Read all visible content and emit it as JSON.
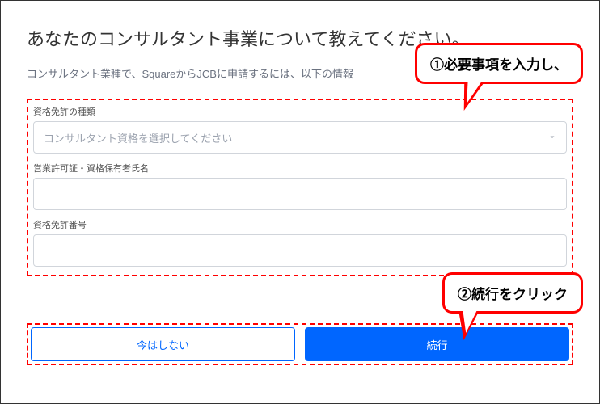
{
  "title": "あなたのコンサルタント事業について教えてください。",
  "description": "コンサルタント業種で、SquareからJCBに申請するには、以下の情報",
  "callouts": {
    "one": "①必要事項を入力し、",
    "two": "②続行をクリック"
  },
  "fields": {
    "license_type": {
      "label": "資格免許の種類",
      "placeholder": "コンサルタント資格を選択してください"
    },
    "holder_name": {
      "label": "営業許可証・資格保有者氏名",
      "value": ""
    },
    "license_number": {
      "label": "資格免許番号",
      "value": ""
    }
  },
  "buttons": {
    "skip": "今はしない",
    "continue": "続行"
  }
}
